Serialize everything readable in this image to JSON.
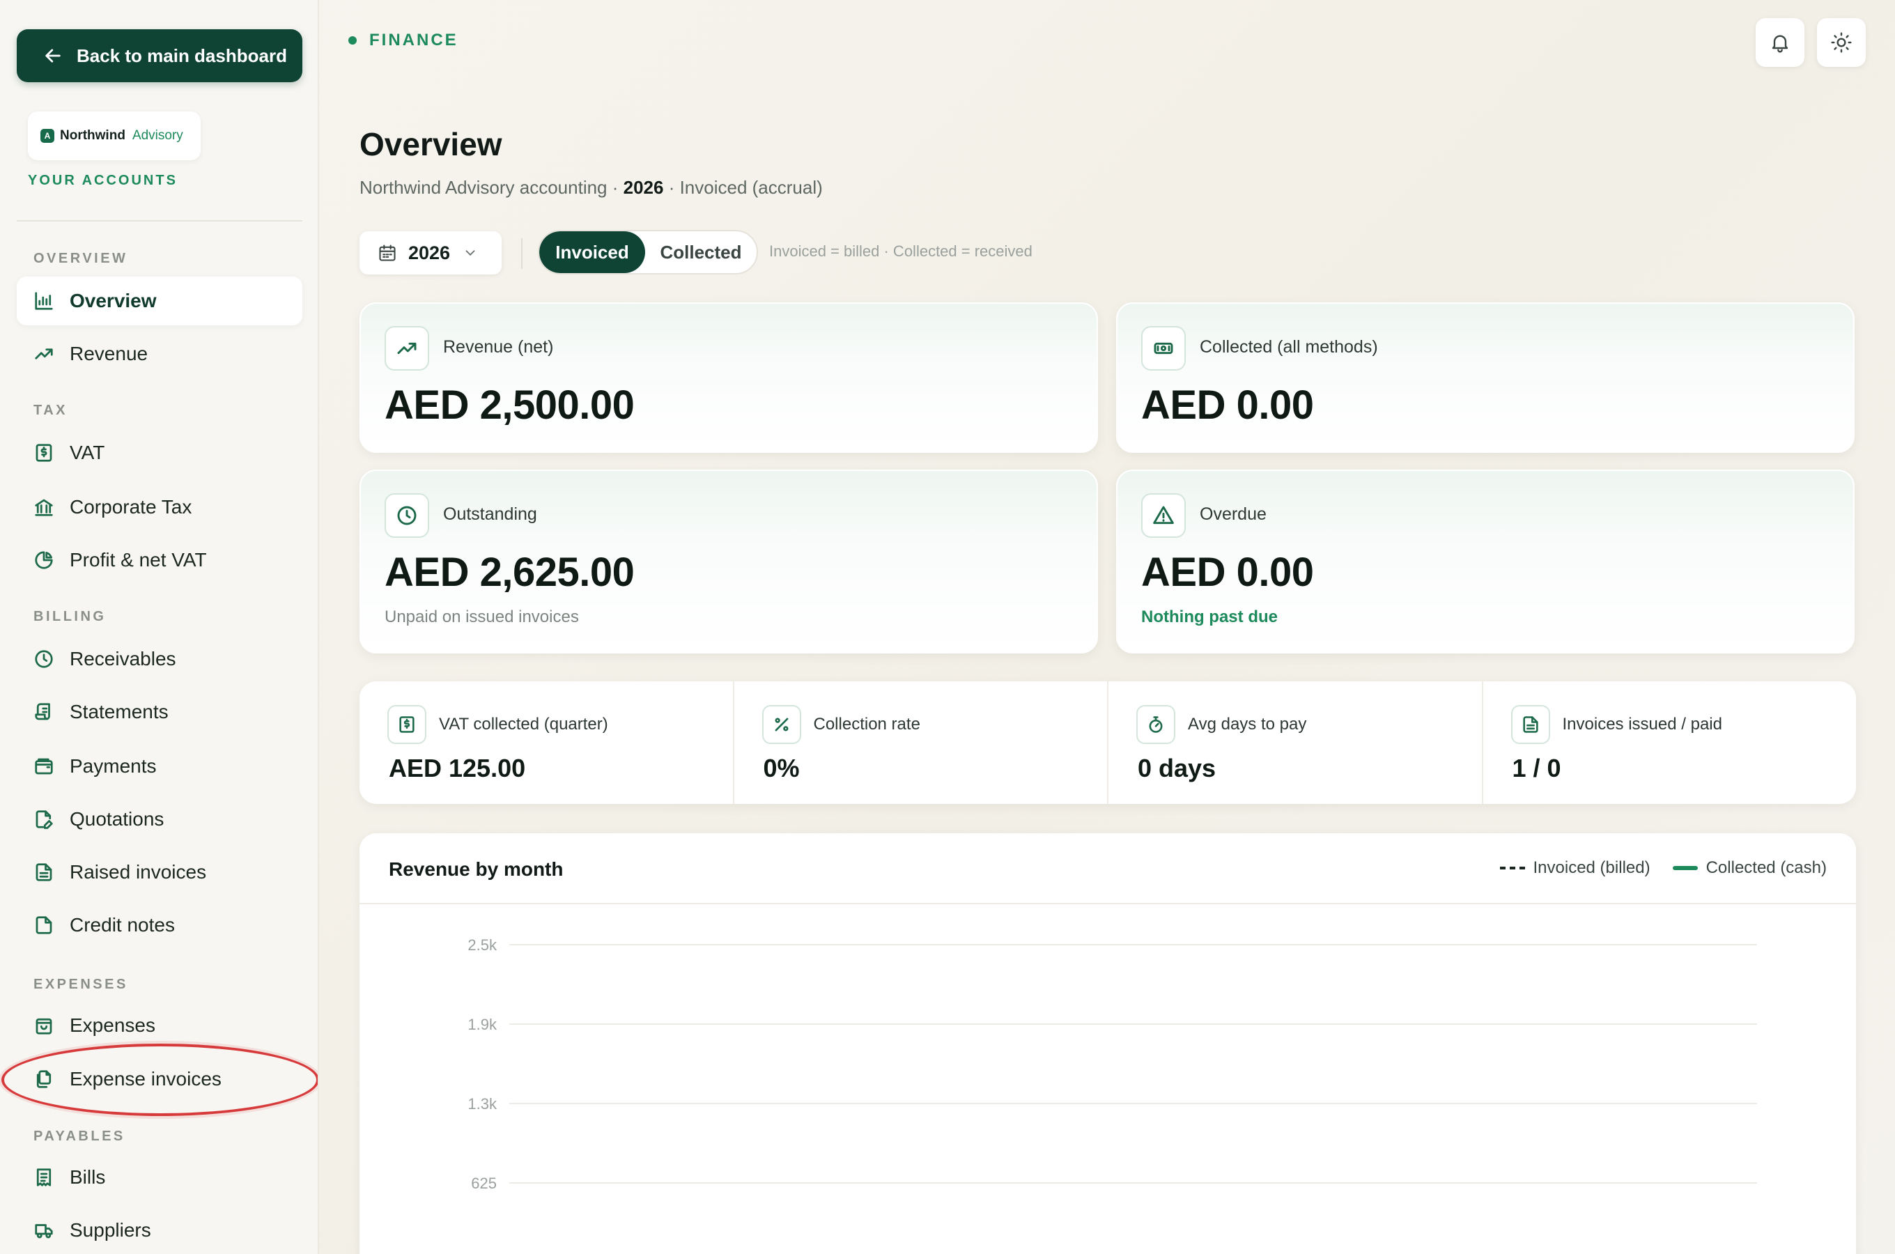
{
  "sidebar": {
    "back_label": "Back to main dashboard",
    "brand": {
      "mark": "A",
      "name": "Northwind",
      "sub": "Advisory"
    },
    "accounts_label": "YOUR ACCOUNTS",
    "sections": {
      "overview": "OVERVIEW",
      "tax": "TAX",
      "billing": "BILLING",
      "expenses": "EXPENSES",
      "payables": "PAYABLES"
    },
    "items": {
      "overview": "Overview",
      "revenue": "Revenue",
      "vat": "VAT",
      "corporate_tax": "Corporate Tax",
      "profit_net_vat": "Profit & net VAT",
      "receivables": "Receivables",
      "statements": "Statements",
      "payments": "Payments",
      "quotations": "Quotations",
      "raised_invoices": "Raised invoices",
      "credit_notes": "Credit notes",
      "expenses": "Expenses",
      "expense_invoices": "Expense invoices",
      "bills": "Bills",
      "suppliers": "Suppliers"
    },
    "active": "overview",
    "highlighted": "expense_invoices"
  },
  "topbar": {
    "section_label": "FINANCE",
    "icons": [
      "bell-icon",
      "sun-icon"
    ]
  },
  "header": {
    "title": "Overview",
    "subtitle_pre": "Northwind Advisory accounting · ",
    "subtitle_year": "2026",
    "subtitle_post": " · Invoiced (accrual)"
  },
  "filters": {
    "year": "2026",
    "segment_invoiced": "Invoiced",
    "segment_collected": "Collected",
    "selected": "Invoiced",
    "hint": "Invoiced = billed · Collected = received"
  },
  "kpis": {
    "revenue": {
      "label": "Revenue (net)",
      "value": "AED 2,500.00",
      "icon": "trend-up-icon"
    },
    "collected": {
      "label": "Collected (all methods)",
      "value": "AED 0.00",
      "icon": "cash-icon"
    },
    "outstanding": {
      "label": "Outstanding",
      "value": "AED 2,625.00",
      "note": "Unpaid on issued invoices",
      "icon": "clock-icon"
    },
    "overdue": {
      "label": "Overdue",
      "value": "AED 0.00",
      "note": "Nothing past due",
      "icon": "warning-icon"
    }
  },
  "stats": {
    "vat": {
      "label": "VAT collected (quarter)",
      "value": "AED 125.00",
      "icon": "receipt-dollar-icon"
    },
    "rate": {
      "label": "Collection rate",
      "value": "0%",
      "icon": "percent-icon"
    },
    "days": {
      "label": "Avg days to pay",
      "value": "0 days",
      "icon": "stopwatch-icon"
    },
    "invoices": {
      "label": "Invoices issued / paid",
      "value": "1 / 0",
      "icon": "document-icon"
    }
  },
  "chart": {
    "title": "Revenue by month",
    "legend_invoiced": "Invoiced (billed)",
    "legend_collected": "Collected (cash)"
  },
  "chart_data": {
    "type": "line",
    "title": "Revenue by month",
    "ylim": [
      0,
      2500
    ],
    "yticks": [
      "2.5k",
      "1.9k",
      "1.3k",
      "625"
    ],
    "ytick_values": [
      2500,
      1875,
      1250,
      625
    ],
    "grid": true,
    "legend_placement": "top-right",
    "series": [
      {
        "name": "Invoiced (billed)",
        "style": "dashed",
        "color": "#1d2722"
      },
      {
        "name": "Collected (cash)",
        "style": "solid",
        "color": "#1d8a5b"
      }
    ]
  },
  "colors": {
    "brand_dark": "#0f4434",
    "accent": "#1d8a5b",
    "highlight_ring": "#d73a3a"
  }
}
